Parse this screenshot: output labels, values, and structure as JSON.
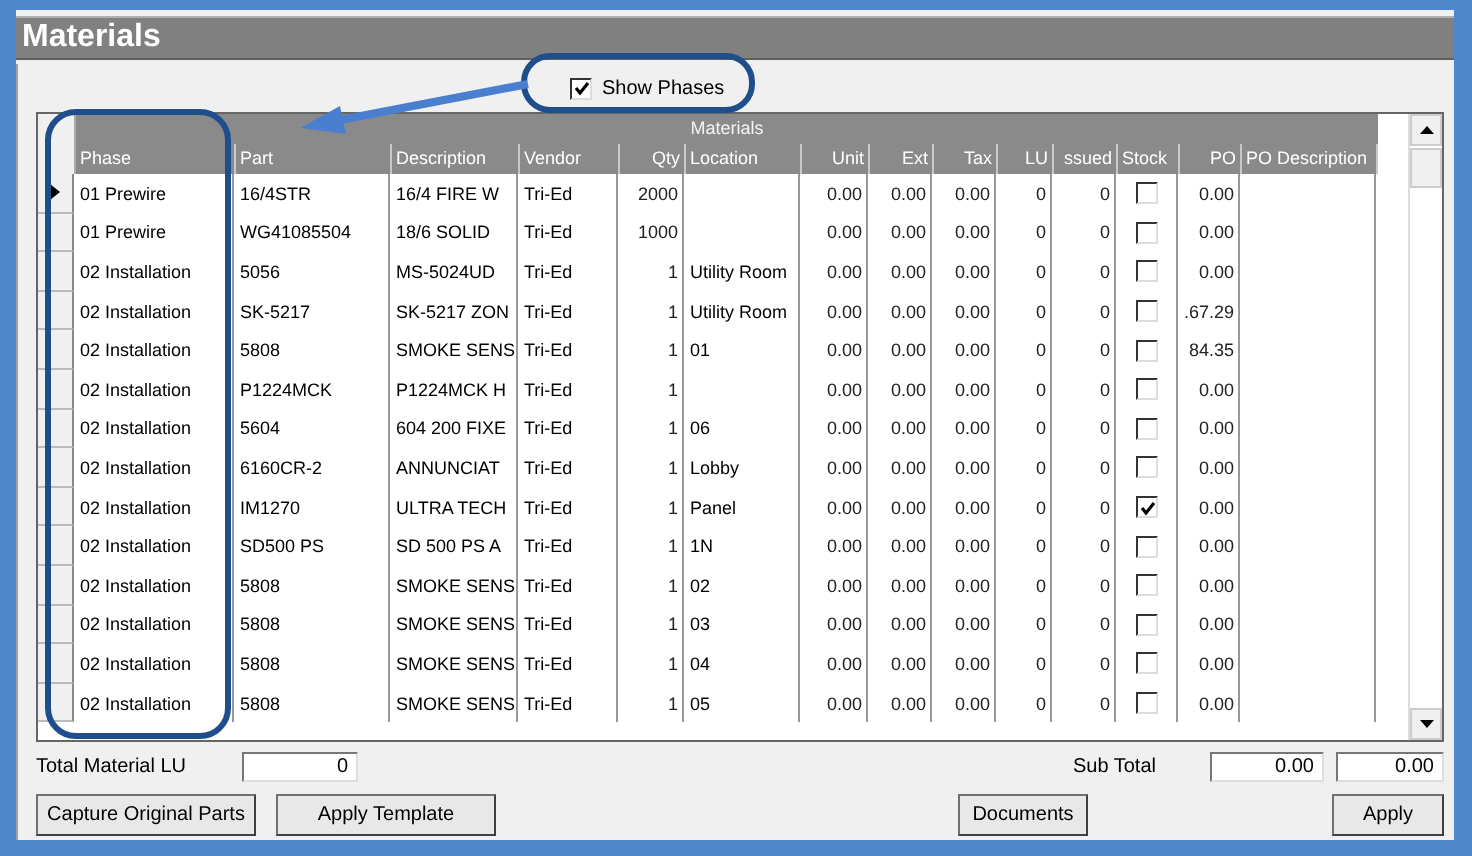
{
  "window": {
    "title": "Materials"
  },
  "show_phases": {
    "label": "Show Phases",
    "checked": true
  },
  "grid": {
    "band": "Materials",
    "columns": [
      {
        "label": "Phase",
        "kind": "text"
      },
      {
        "label": "Part",
        "kind": "text"
      },
      {
        "label": "Description",
        "kind": "text"
      },
      {
        "label": "Vendor",
        "kind": "text"
      },
      {
        "label": "Qty",
        "kind": "number"
      },
      {
        "label": "Location",
        "kind": "text"
      },
      {
        "label": "Unit",
        "kind": "number"
      },
      {
        "label": "Ext",
        "kind": "number"
      },
      {
        "label": "Tax",
        "kind": "number"
      },
      {
        "label": "LU",
        "kind": "number"
      },
      {
        "label": "ssued",
        "kind": "number"
      },
      {
        "label": "Stock",
        "kind": "check"
      },
      {
        "label": "PO",
        "kind": "number"
      },
      {
        "label": "PO Description",
        "kind": "text"
      }
    ],
    "rows": [
      {
        "selected": true,
        "stock": false,
        "cells": [
          "01 Prewire",
          "16/4STR",
          "16/4 FIRE W",
          "Tri-Ed",
          "2000",
          null,
          "0.00",
          "0.00",
          "0.00",
          "0",
          "0",
          "0.00",
          null
        ]
      },
      {
        "selected": false,
        "stock": false,
        "cells": [
          "01 Prewire",
          "WG41085504",
          "18/6 SOLID",
          "Tri-Ed",
          "1000",
          null,
          "0.00",
          "0.00",
          "0.00",
          "0",
          "0",
          "0.00",
          null
        ]
      },
      {
        "selected": false,
        "stock": false,
        "cells": [
          "02 Installation",
          "5056",
          "MS-5024UD",
          "Tri-Ed",
          "1",
          "Utility Room",
          "0.00",
          "0.00",
          "0.00",
          "0",
          "0",
          "0.00",
          null
        ]
      },
      {
        "selected": false,
        "stock": false,
        "cells": [
          "02 Installation",
          "SK-5217",
          "SK-5217 ZON",
          "Tri-Ed",
          "1",
          "Utility Room",
          "0.00",
          "0.00",
          "0.00",
          "0",
          "0",
          ".67.29",
          null
        ]
      },
      {
        "selected": false,
        "stock": false,
        "cells": [
          "02 Installation",
          "5808",
          "SMOKE SENS",
          "Tri-Ed",
          "1",
          "01",
          "0.00",
          "0.00",
          "0.00",
          "0",
          "0",
          "84.35",
          null
        ]
      },
      {
        "selected": false,
        "stock": false,
        "cells": [
          "02 Installation",
          "P1224MCK",
          "P1224MCK H",
          "Tri-Ed",
          "1",
          null,
          "0.00",
          "0.00",
          "0.00",
          "0",
          "0",
          "0.00",
          null
        ]
      },
      {
        "selected": false,
        "stock": false,
        "cells": [
          "02 Installation",
          "5604",
          "604 200 FIXE",
          "Tri-Ed",
          "1",
          "06",
          "0.00",
          "0.00",
          "0.00",
          "0",
          "0",
          "0.00",
          null
        ]
      },
      {
        "selected": false,
        "stock": false,
        "cells": [
          "02 Installation",
          "6160CR-2",
          "ANNUNCIAT",
          "Tri-Ed",
          "1",
          "Lobby",
          "0.00",
          "0.00",
          "0.00",
          "0",
          "0",
          "0.00",
          null
        ]
      },
      {
        "selected": false,
        "stock": true,
        "cells": [
          "02 Installation",
          "IM1270",
          "ULTRA TECH",
          "Tri-Ed",
          "1",
          "Panel",
          "0.00",
          "0.00",
          "0.00",
          "0",
          "0",
          "0.00",
          null
        ]
      },
      {
        "selected": false,
        "stock": false,
        "cells": [
          "02 Installation",
          "SD500 PS",
          "SD 500 PS A",
          "Tri-Ed",
          "1",
          "1N",
          "0.00",
          "0.00",
          "0.00",
          "0",
          "0",
          "0.00",
          null
        ]
      },
      {
        "selected": false,
        "stock": false,
        "cells": [
          "02 Installation",
          "5808",
          "SMOKE SENS",
          "Tri-Ed",
          "1",
          "02",
          "0.00",
          "0.00",
          "0.00",
          "0",
          "0",
          "0.00",
          null
        ]
      },
      {
        "selected": false,
        "stock": false,
        "cells": [
          "02 Installation",
          "5808",
          "SMOKE SENS",
          "Tri-Ed",
          "1",
          "03",
          "0.00",
          "0.00",
          "0.00",
          "0",
          "0",
          "0.00",
          null
        ]
      },
      {
        "selected": false,
        "stock": false,
        "cells": [
          "02 Installation",
          "5808",
          "SMOKE SENS",
          "Tri-Ed",
          "1",
          "04",
          "0.00",
          "0.00",
          "0.00",
          "0",
          "0",
          "0.00",
          null
        ]
      },
      {
        "selected": false,
        "stock": false,
        "cells": [
          "02 Installation",
          "5808",
          "SMOKE SENS",
          "Tri-Ed",
          "1",
          "05",
          "0.00",
          "0.00",
          "0.00",
          "0",
          "0",
          "0.00",
          null
        ]
      }
    ]
  },
  "total_material_lu": {
    "label": "Total Material LU",
    "value": "0"
  },
  "sub_total": {
    "label": "Sub Total",
    "values": [
      "0.00",
      "0.00"
    ]
  },
  "buttons_left": [
    "Capture Original Parts",
    "Apply Template"
  ],
  "buttons_right": [
    "Documents",
    "Apply"
  ]
}
